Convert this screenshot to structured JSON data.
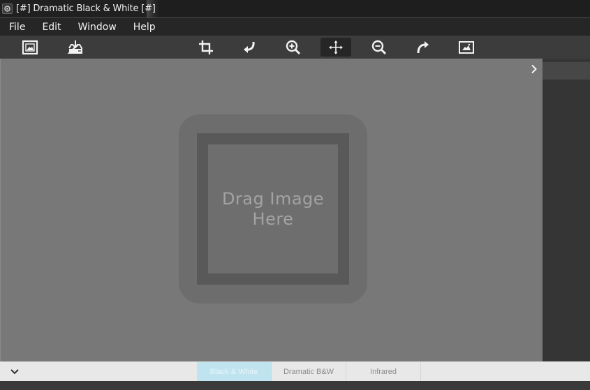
{
  "window": {
    "title": "[#] Dramatic Black & White [#]",
    "icon": "app-icon"
  },
  "menu": {
    "items": [
      "File",
      "Edit",
      "Window",
      "Help"
    ]
  },
  "toolbar": {
    "buttons": [
      {
        "name": "open-image",
        "icon": "image-frame-icon"
      },
      {
        "name": "save-image",
        "icon": "download-tray-icon"
      },
      {
        "name": "crop",
        "icon": "crop-icon"
      },
      {
        "name": "undo",
        "icon": "undo-arrow-icon"
      },
      {
        "name": "zoom-in",
        "icon": "zoom-in-icon"
      },
      {
        "name": "pan",
        "icon": "move-arrows-icon",
        "active": true
      },
      {
        "name": "zoom-out",
        "icon": "zoom-out-icon"
      },
      {
        "name": "redo",
        "icon": "redo-arrow-icon"
      },
      {
        "name": "fit-image",
        "icon": "image-fit-icon"
      }
    ]
  },
  "canvas": {
    "drop_text_line1": "Drag Image",
    "drop_text_line2": "Here"
  },
  "presets": {
    "tabs": [
      "Black & White",
      "Dramatic B&W",
      "Infrared"
    ],
    "active_index": 0
  },
  "colors": {
    "canvas_bg": "#787878",
    "active_tab": "#bfe4ef",
    "toolbar_bg": "#3c3c3c"
  }
}
